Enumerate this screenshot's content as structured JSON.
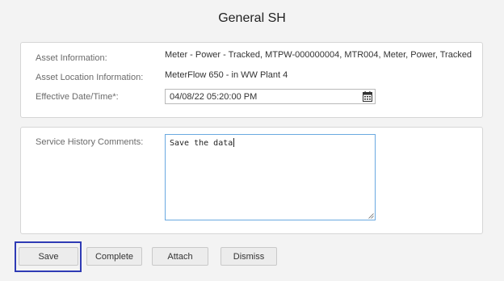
{
  "header": {
    "title": "General SH"
  },
  "asset_panel": {
    "asset_info_label": "Asset Information:",
    "asset_info_value": "Meter - Power - Tracked, MTPW-000000004, MTR004, Meter, Power, Tracked",
    "location_label": "Asset Location Information:",
    "location_value": "MeterFlow 650 - in WW Plant 4",
    "effective_label": "Effective Date/Time*:",
    "effective_value": "04/08/22 05:20:00 PM",
    "calendar_icon": "calendar-icon"
  },
  "comments_panel": {
    "label": "Service History Comments:",
    "value": "Save the data"
  },
  "buttons": {
    "save": "Save",
    "complete": "Complete",
    "attach": "Attach",
    "dismiss": "Dismiss"
  },
  "colors": {
    "focus_ring": "#2f3bb5",
    "textarea_border": "#6aa9e0",
    "background": "#f3f3f3"
  }
}
